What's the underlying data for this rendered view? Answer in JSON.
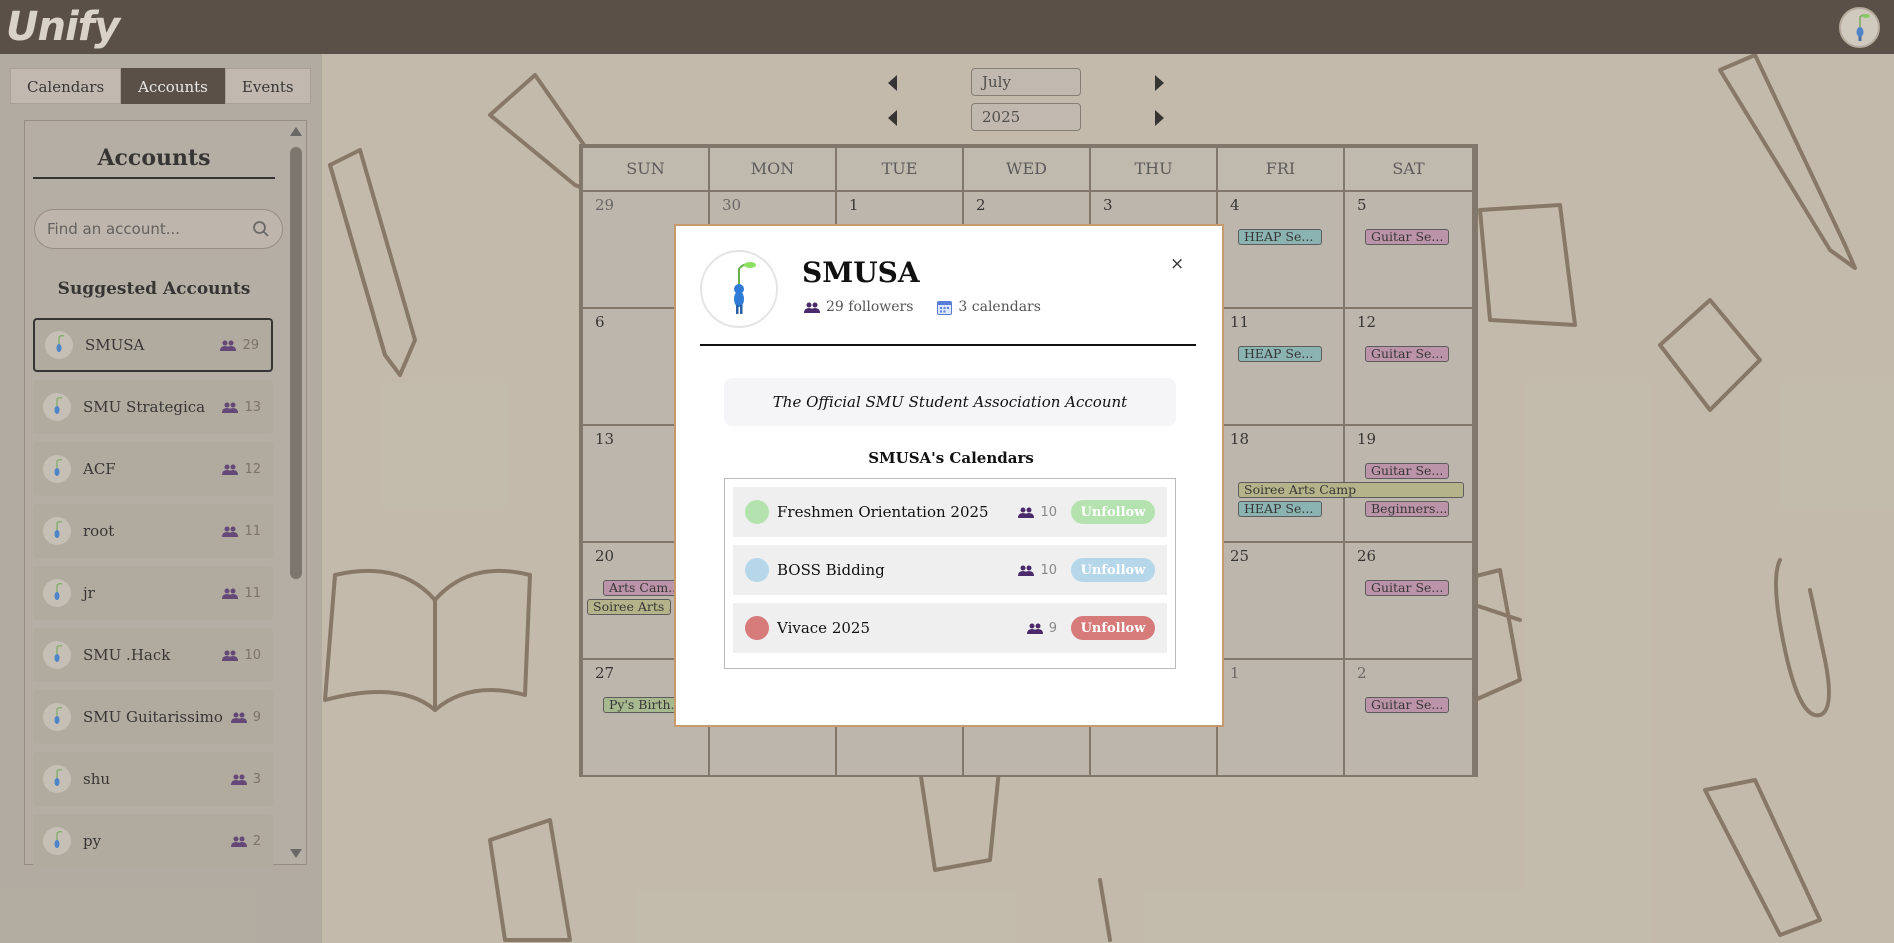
{
  "app": {
    "logo": "Unify"
  },
  "sidebar": {
    "tabs": [
      {
        "label": "Calendars",
        "active": false
      },
      {
        "label": "Accounts",
        "active": true
      },
      {
        "label": "Events",
        "active": false
      }
    ],
    "panel_title": "Accounts",
    "search_placeholder": "Find an account...",
    "suggested_title": "Suggested Accounts",
    "accounts": [
      {
        "name": "SMUSA",
        "followers": "29",
        "selected": true
      },
      {
        "name": "SMU Strategica",
        "followers": "13"
      },
      {
        "name": "ACF",
        "followers": "12"
      },
      {
        "name": "root",
        "followers": "11"
      },
      {
        "name": "jr",
        "followers": "11"
      },
      {
        "name": "SMU .Hack",
        "followers": "10"
      },
      {
        "name": "SMU Guitarissimo",
        "followers": "9"
      },
      {
        "name": "shu",
        "followers": "3"
      },
      {
        "name": "py",
        "followers": "2"
      }
    ]
  },
  "nav": {
    "month": "July",
    "year": "2025"
  },
  "calendar": {
    "weekdays": [
      "SUN",
      "MON",
      "TUE",
      "WED",
      "THU",
      "FRI",
      "SAT"
    ],
    "weeks": [
      [
        "29",
        "30",
        "1",
        "2",
        "3",
        "4",
        "5"
      ],
      [
        "6",
        "",
        "",
        "",
        "",
        "11",
        "12"
      ],
      [
        "13",
        "",
        "",
        "",
        "",
        "18",
        "19"
      ],
      [
        "20",
        "",
        "",
        "",
        "",
        "25",
        "26"
      ],
      [
        "27",
        "",
        "",
        "",
        "",
        "1",
        "2"
      ]
    ],
    "events": {
      "heap1": "HEAP Se...",
      "guitar1": "Guitar Se...",
      "heap2": "HEAP Se...",
      "guitar2": "Guitar Se...",
      "guitar3": "Guitar Se...",
      "soiree": "Soiree Arts Camp",
      "heap3": "HEAP Se...",
      "beginners": "Beginners...",
      "arts": "Arts Cam...",
      "soiree2": "Soiree Arts ...",
      "guitar4": "Guitar Se...",
      "birthday": "Py's Birth...",
      "guitar5": "Guitar Se..."
    },
    "colors": {
      "heap": "#7fb8b8",
      "guitar": "#c28fae",
      "soiree": "#b7b983",
      "gray": "#8f9aa3",
      "bday": "#a6c08a"
    }
  },
  "modal": {
    "name": "SMUSA",
    "followers": "29 followers",
    "calendars_count": "3 calendars",
    "close": "×",
    "description": "The Official SMU Student Association Account",
    "calendars_title": "SMUSA's Calendars",
    "calendars": [
      {
        "name": "Freshmen Orientation 2025",
        "followers": "10",
        "button": "Unfollow",
        "color": "#b5e3b0",
        "btn_color": "#b5e3b0"
      },
      {
        "name": "BOSS Bidding",
        "followers": "10",
        "button": "Unfollow",
        "color": "#b6d6ea",
        "btn_color": "#b6d6ea"
      },
      {
        "name": "Vivace 2025",
        "followers": "9",
        "button": "Unfollow",
        "color": "#d77a7a",
        "btn_color": "#d77a7a"
      }
    ]
  }
}
